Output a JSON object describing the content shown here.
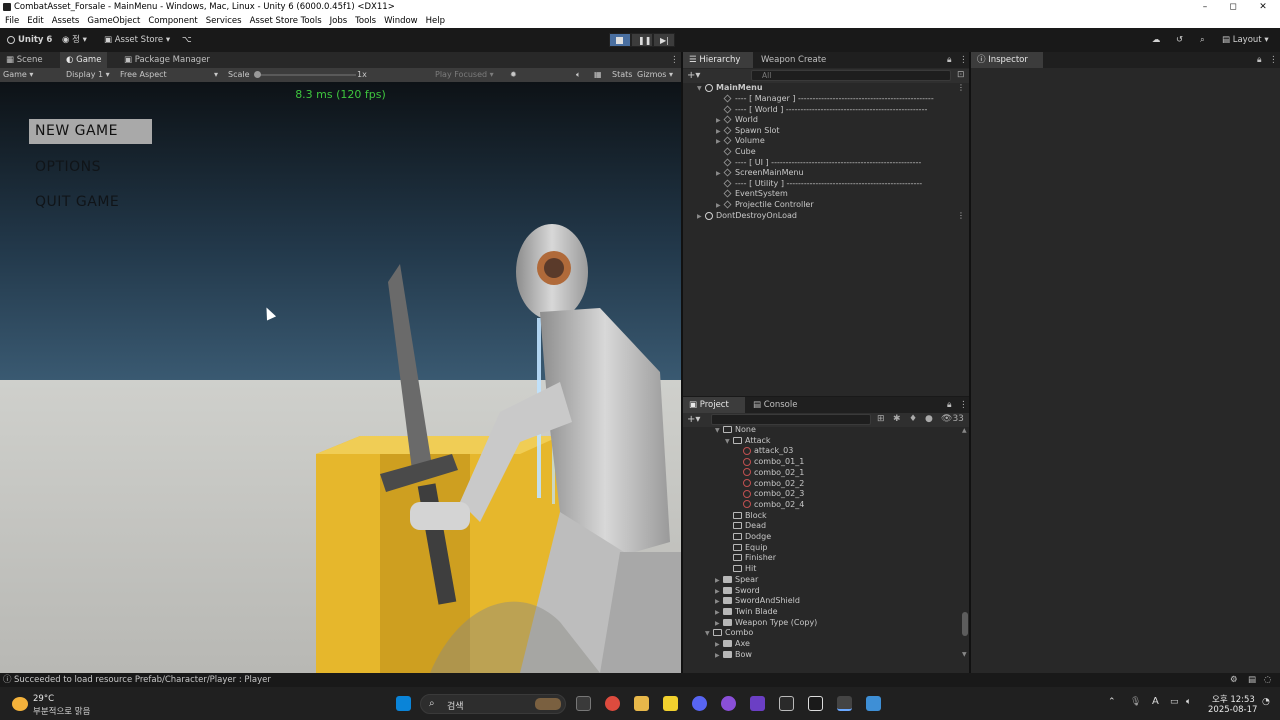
{
  "window": {
    "title": "CombatAsset_Forsale - MainMenu - Windows, Mac, Linux - Unity 6 (6000.0.45f1) <DX11>",
    "min_glyph": "–",
    "max_glyph": "◻",
    "close_glyph": "✕"
  },
  "menu": [
    "File",
    "Edit",
    "Assets",
    "GameObject",
    "Component",
    "Services",
    "Asset Store Tools",
    "Jobs",
    "Tools",
    "Window",
    "Help"
  ],
  "toolbar": {
    "unity_label": "Unity 6",
    "account_label": "정",
    "asset_store_label": "Asset Store",
    "layout_label": "Layout"
  },
  "scene_tabs": [
    "Scene",
    "Game",
    "Package Manager"
  ],
  "game_bar": {
    "display_mode": "Game",
    "display": "Display 1",
    "aspect": "Free Aspect",
    "scale_label": "Scale",
    "scale_value": "1x",
    "play_focused": "Play Focused",
    "stats": "Stats",
    "gizmos": "Gizmos"
  },
  "game": {
    "fps_text": "8.3 ms (120 fps)",
    "menu_items": [
      "NEW GAME",
      "OPTIONS",
      "QUIT GAME"
    ]
  },
  "hierarchy": {
    "tabs": [
      "Hierarchy",
      "Weapon Create"
    ],
    "search_placeholder": "All",
    "scene_name": "MainMenu",
    "items": [
      {
        "label": "---- [ Manager ] -----------------------------------------------",
        "arrow": ""
      },
      {
        "label": "---- [ World ] -------------------------------------------------",
        "arrow": ""
      },
      {
        "label": "World",
        "arrow": "▶"
      },
      {
        "label": "Spawn Slot",
        "arrow": "▶"
      },
      {
        "label": "Volume",
        "arrow": "▶"
      },
      {
        "label": "Cube",
        "arrow": ""
      },
      {
        "label": "---- [ UI ] ----------------------------------------------------",
        "arrow": ""
      },
      {
        "label": "ScreenMainMenu",
        "arrow": "▶"
      },
      {
        "label": "---- [ Utility ] -----------------------------------------------",
        "arrow": ""
      },
      {
        "label": "EventSystem",
        "arrow": ""
      },
      {
        "label": "Projectile Controller",
        "arrow": "▶"
      }
    ],
    "dont_destroy": "DontDestroyOnLoad"
  },
  "inspector": {
    "tab": "Inspector"
  },
  "project": {
    "tabs": [
      "Project",
      "Console"
    ],
    "count": "33",
    "rows": [
      {
        "label": "None",
        "type": "folder-open",
        "indent": 1,
        "arrow": "▼"
      },
      {
        "label": "Attack",
        "type": "folder-open",
        "indent": 2,
        "arrow": "▼"
      },
      {
        "label": "attack_03",
        "type": "anim",
        "indent": 3,
        "arrow": ""
      },
      {
        "label": "combo_01_1",
        "type": "anim",
        "indent": 3,
        "arrow": ""
      },
      {
        "label": "combo_02_1",
        "type": "anim",
        "indent": 3,
        "arrow": ""
      },
      {
        "label": "combo_02_2",
        "type": "anim",
        "indent": 3,
        "arrow": ""
      },
      {
        "label": "combo_02_3",
        "type": "anim",
        "indent": 3,
        "arrow": ""
      },
      {
        "label": "combo_02_4",
        "type": "anim",
        "indent": 3,
        "arrow": ""
      },
      {
        "label": "Block",
        "type": "folder-open",
        "indent": 2,
        "arrow": ""
      },
      {
        "label": "Dead",
        "type": "folder-open",
        "indent": 2,
        "arrow": ""
      },
      {
        "label": "Dodge",
        "type": "folder-open",
        "indent": 2,
        "arrow": ""
      },
      {
        "label": "Equip",
        "type": "folder-open",
        "indent": 2,
        "arrow": ""
      },
      {
        "label": "Finisher",
        "type": "folder-open",
        "indent": 2,
        "arrow": ""
      },
      {
        "label": "Hit",
        "type": "folder-open",
        "indent": 2,
        "arrow": ""
      },
      {
        "label": "Spear",
        "type": "folder",
        "indent": 1,
        "arrow": "▶"
      },
      {
        "label": "Sword",
        "type": "folder",
        "indent": 1,
        "arrow": "▶"
      },
      {
        "label": "SwordAndShield",
        "type": "folder",
        "indent": 1,
        "arrow": "▶"
      },
      {
        "label": "Twin Blade",
        "type": "folder",
        "indent": 1,
        "arrow": "▶"
      },
      {
        "label": "Weapon Type (Copy)",
        "type": "folder",
        "indent": 1,
        "arrow": "▶"
      },
      {
        "label": "Combo",
        "type": "folder-open",
        "indent": 0,
        "arrow": "▼"
      },
      {
        "label": "Axe",
        "type": "folder",
        "indent": 1,
        "arrow": "▶"
      },
      {
        "label": "Bow",
        "type": "folder",
        "indent": 1,
        "arrow": "▶"
      }
    ]
  },
  "status": {
    "message": "Succeeded to load resource Prefab/Character/Player : Player"
  },
  "taskbar": {
    "weather_temp": "29°C",
    "weather_desc": "부분적으로 맑음",
    "search_label": "검색",
    "time": "오후 12:53",
    "date": "2025-08-17",
    "ime": "A"
  },
  "colors": {
    "fps_green": "#3ec63e",
    "selected_menu_bg": "#a9a9a9",
    "cube_yellow": "#e6b72c"
  }
}
